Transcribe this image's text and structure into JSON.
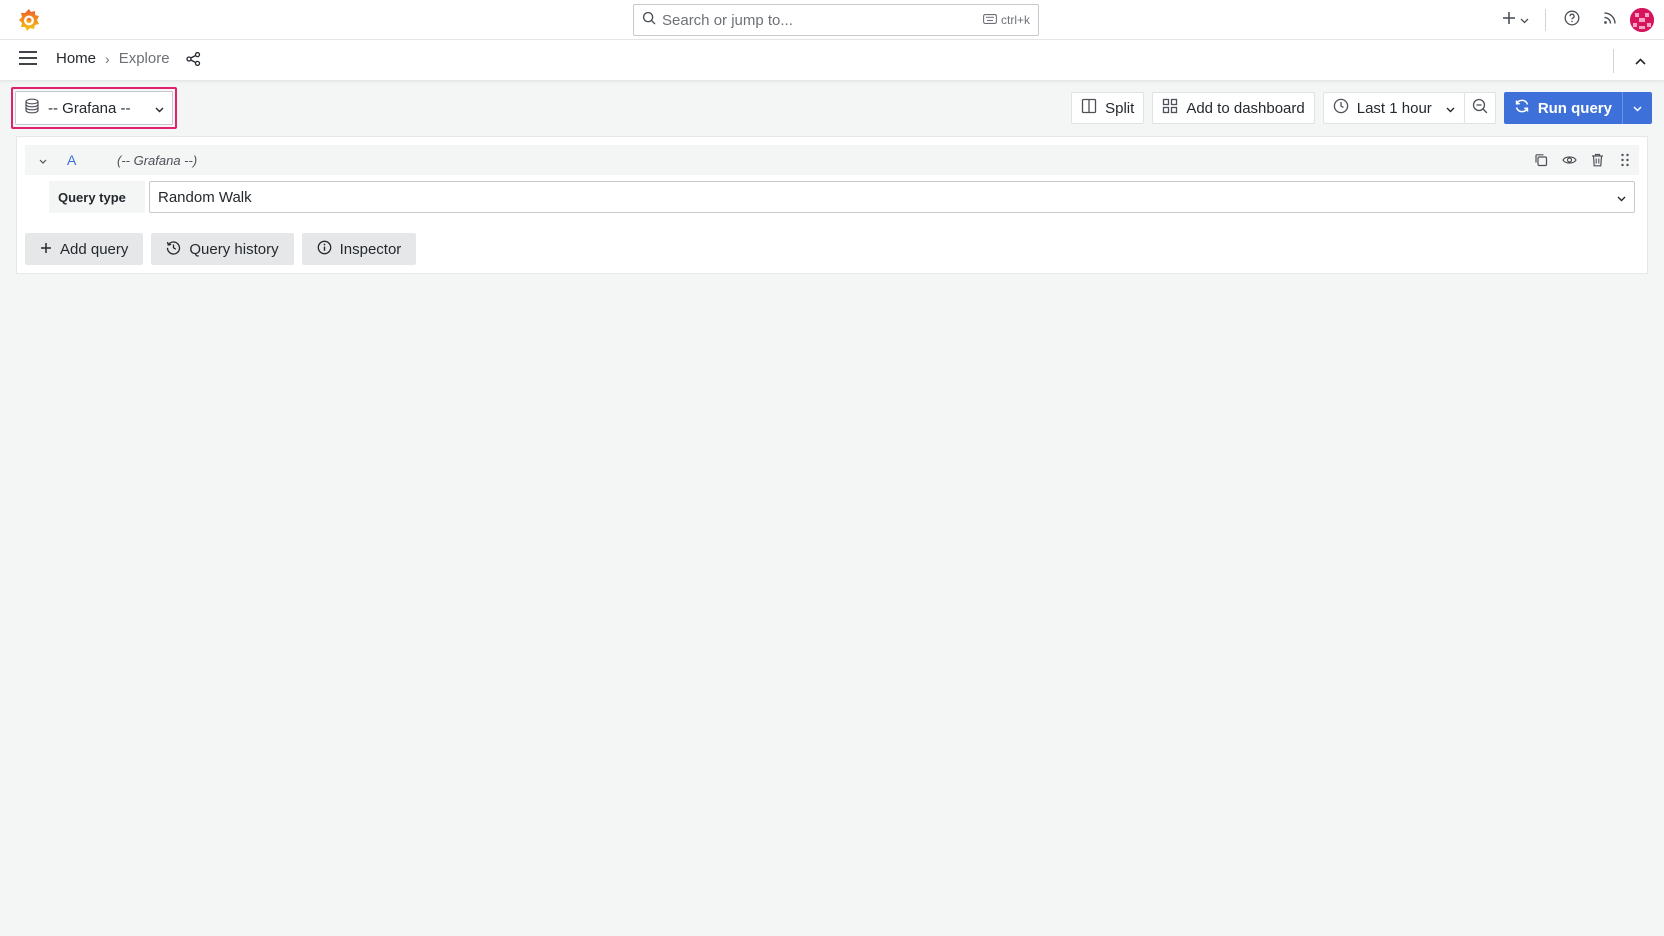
{
  "topbar": {
    "search_placeholder": "Search or jump to...",
    "search_shortcut": "ctrl+k",
    "icons": [
      "grafana-logo-icon",
      "search-icon",
      "keyboard-icon",
      "plus-icon",
      "help-icon",
      "rss-icon",
      "avatar"
    ]
  },
  "breadcrumb": {
    "home": "Home",
    "separator": "›",
    "current": "Explore"
  },
  "toolbar": {
    "datasource": "-- Grafana --",
    "split_label": "Split",
    "add_to_dashboard_label": "Add to dashboard",
    "time_range_label": "Last 1 hour",
    "run_query_label": "Run query"
  },
  "query": {
    "ref_id": "A",
    "datasource_name": "(-- Grafana --)",
    "query_type_label": "Query type",
    "query_type_value": "Random Walk"
  },
  "actions": {
    "add_query": "Add query",
    "query_history": "Query history",
    "inspector": "Inspector"
  },
  "colors": {
    "primary": "#3d71d9",
    "highlight": "#e0226e",
    "background": "#f4f5f5"
  }
}
